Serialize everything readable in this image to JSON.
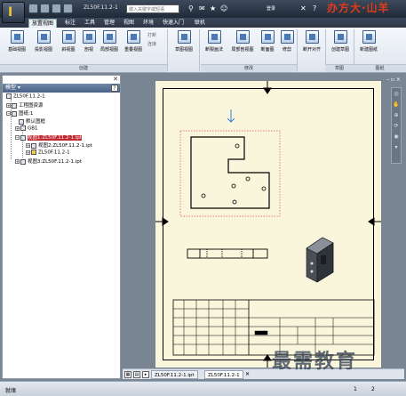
{
  "title": {
    "file": "ZL50F.11.2-1",
    "search_placeholder": "键入关键字或短语",
    "login": "登录",
    "brand_overlay": "办方大·山羊"
  },
  "tabs": [
    "放置视图",
    "标注",
    "工具",
    "管理",
    "视图",
    "环境",
    "快速入门",
    "联机"
  ],
  "ribbon": {
    "buttons": [
      "基础视图",
      "投影视图",
      "斜视图",
      "剖视",
      "局部视图",
      "重叠视图",
      "草图视图",
      "断裂画法",
      "局部剖视图",
      "断面图",
      "修剪",
      "断开对齐",
      "创建草图",
      "新建图纸"
    ],
    "small_buttons": [
      "打断",
      "连接"
    ],
    "groups": [
      "创建",
      "修改",
      "草图",
      "图纸"
    ]
  },
  "browser": {
    "title": "模型",
    "nodes": [
      "ZL50F.11.2-1",
      "工程图资源",
      "图纸:1",
      "默认图框",
      "GB1",
      "视图1:ZL50F.11.2-1.ipt",
      "视图2:ZL50F.11.2-1.ipt",
      "ZL50F.11.2-1",
      "视图3:ZL50F.11.2-1.ipt"
    ]
  },
  "doc_tabs": [
    "ZL50F.11.2-1.ipt",
    "ZL50F.11.2-1"
  ],
  "status": {
    "text": "就绪",
    "page_a": "1",
    "page_b": "2"
  },
  "watermark": "最需教育",
  "colors": {
    "sheet": "#f9f6dc",
    "canvas": "#7a8594",
    "selection": "#c0262d",
    "accent_arrow": "#3a7bd5"
  }
}
